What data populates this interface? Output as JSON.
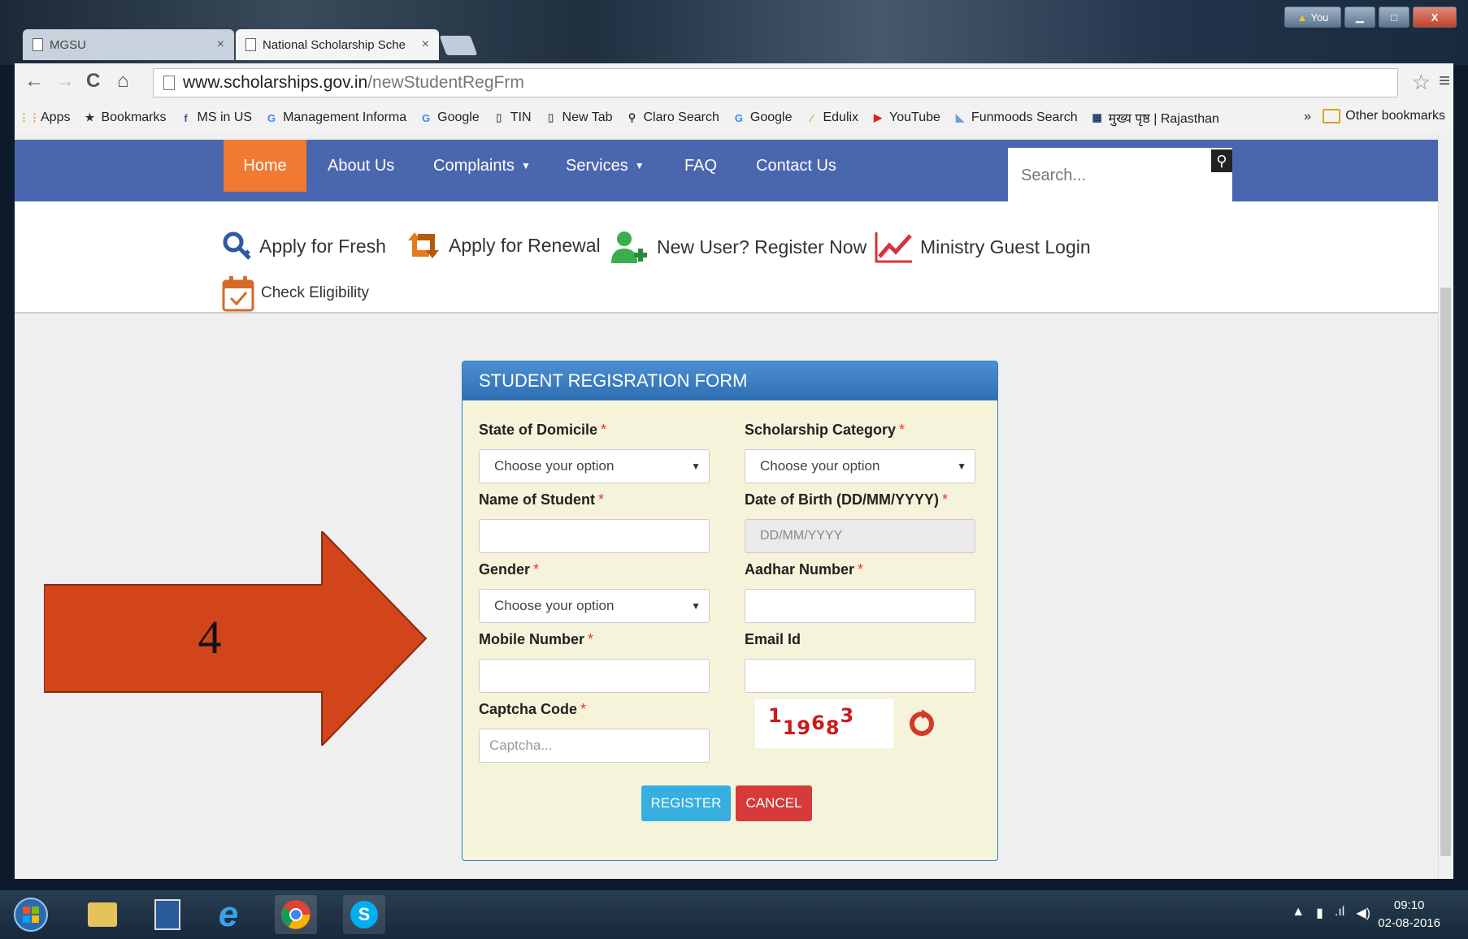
{
  "window": {
    "user_badge": "You",
    "min": "▁",
    "max": "□",
    "close": "X"
  },
  "tabs": [
    {
      "label": "MGSU",
      "close": "×"
    },
    {
      "label": "National Scholarship Sche",
      "close": "×"
    }
  ],
  "address": {
    "host": "www.scholarships.gov.in",
    "path": "/newStudentRegFrm"
  },
  "bookmarks": [
    {
      "label": "Apps",
      "icon": "apps-grid-icon",
      "glyph": "⋮⋮",
      "color": "#e0a020"
    },
    {
      "label": "Bookmarks",
      "icon": "star-icon",
      "glyph": "★",
      "color": "#333333"
    },
    {
      "label": "MS in US",
      "icon": "facebook-icon",
      "glyph": "f",
      "color": "#3b5998"
    },
    {
      "label": "Management Informa",
      "icon": "google-icon",
      "glyph": "G",
      "color": "#4285f4"
    },
    {
      "label": "Google",
      "icon": "google-icon",
      "glyph": "G",
      "color": "#4285f4"
    },
    {
      "label": "TIN",
      "icon": "page-icon",
      "glyph": "▯",
      "color": "#666666"
    },
    {
      "label": "New Tab",
      "icon": "page-icon",
      "glyph": "▯",
      "color": "#666666"
    },
    {
      "label": "Claro Search",
      "icon": "search-icon",
      "glyph": "⚲",
      "color": "#333333"
    },
    {
      "label": "Google",
      "icon": "google-icon",
      "glyph": "G",
      "color": "#4285f4"
    },
    {
      "label": "Edulix",
      "icon": "edulix-icon",
      "glyph": "⁄",
      "color": "#e0b020"
    },
    {
      "label": "YouTube",
      "icon": "youtube-icon",
      "glyph": "▶",
      "color": "#e02020"
    },
    {
      "label": "Funmoods Search",
      "icon": "funmoods-icon",
      "glyph": "◣",
      "color": "#6aa0d8"
    },
    {
      "label": "मुख्य पृष्ठ | Rajasthan",
      "icon": "rajasthan-icon",
      "glyph": "▦",
      "color": "#1a3a6a"
    }
  ],
  "bookmarks_overflow": "»",
  "other_bookmarks": "Other bookmarks",
  "site_nav": {
    "items": [
      "Home",
      "About Us",
      "Complaints",
      "Services",
      "FAQ",
      "Contact Us"
    ],
    "search_placeholder": "Search...",
    "active_color": "#f07a31",
    "bar_color": "#4a66ae"
  },
  "quick_links": {
    "apply_fresh": "Apply for Fresh",
    "apply_renewal": "Apply for Renewal",
    "register": "New User? Register Now",
    "ministry_login": "Ministry Guest Login",
    "eligibility": "Check Eligibility"
  },
  "form": {
    "title": "STUDENT REGISRATION FORM",
    "required_mark": "*",
    "state_label": "State of Domicile",
    "state_value": "Choose your option",
    "category_label": "Scholarship Category",
    "category_value": "Choose your option",
    "name_label": "Name of Student",
    "name_value": "",
    "dob_label": "Date of Birth (DD/MM/YYYY)",
    "dob_placeholder": "DD/MM/YYYY",
    "gender_label": "Gender",
    "gender_value": "Choose your option",
    "aadhar_label": "Aadhar Number",
    "aadhar_value": "",
    "mobile_label": "Mobile Number",
    "mobile_value": "",
    "email_label": "Email Id",
    "email_value": "",
    "captcha_label": "Captcha Code",
    "captcha_placeholder": "Captcha...",
    "captcha_chars": [
      "1",
      "1",
      "9",
      "6",
      "8",
      "3"
    ],
    "register": "REGISTER",
    "cancel": "CANCEL"
  },
  "annotation": {
    "number": "4",
    "color": "#d2441a"
  },
  "taskbar": {
    "time": "09:10",
    "date": "02-08-2016"
  }
}
